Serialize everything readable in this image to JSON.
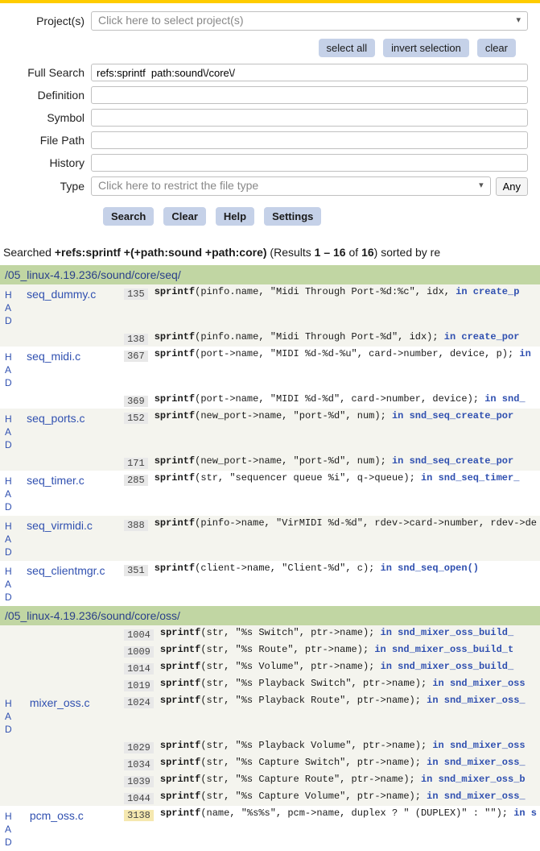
{
  "form": {
    "labels": {
      "projects": "Project(s)",
      "full_search": "Full Search",
      "definition": "Definition",
      "symbol": "Symbol",
      "file_path": "File Path",
      "history": "History",
      "type": "Type"
    },
    "values": {
      "projects_placeholder": "Click here to select project(s)",
      "full_search": "refs:sprintf  path:sound\\/core\\/",
      "definition": "",
      "symbol": "",
      "file_path": "",
      "history": "",
      "type_placeholder": "Click here to restrict the file type"
    },
    "buttons": {
      "select_all": "select all",
      "invert_selection": "invert selection",
      "clear_top": "clear",
      "any": "Any",
      "search": "Search",
      "clear": "Clear",
      "help": "Help",
      "settings": "Settings"
    }
  },
  "status": {
    "prefix": "Searched ",
    "query": "+refs:sprintf +(+path:sound +path:core)",
    "results_label": " (Results ",
    "range": "1 – 16",
    "of_label": " of ",
    "total": "16",
    "suffix": ") sorted by re"
  },
  "had": "H A D",
  "groups": [
    {
      "path": "/05_linux-4.19.236/sound/core/seq/",
      "files": [
        {
          "name": "seq_dummy.c",
          "odd": true,
          "lines": [
            {
              "n": "135",
              "code_pre": "(pinfo.name, \"Midi Through Port-%d:%c\", idx, ",
              "fn": "in create_p",
              "code_post": ""
            },
            {
              "n": "138",
              "code_pre": "(pinfo.name, \"Midi Through Port-%d\", idx); ",
              "fn": "in create_por",
              "code_post": ""
            }
          ]
        },
        {
          "name": "seq_midi.c",
          "odd": false,
          "lines": [
            {
              "n": "367",
              "code_pre": "(port->name, \"MIDI %d-%d-%u\", card->number, device, p); ",
              "fn": "in",
              "code_post": ""
            },
            {
              "n": "369",
              "code_pre": "(port->name, \"MIDI %d-%d\", card->number, device); ",
              "fn": "in snd_",
              "code_post": ""
            }
          ]
        },
        {
          "name": "seq_ports.c",
          "odd": true,
          "lines": [
            {
              "n": "152",
              "code_pre": "(new_port->name, \"port-%d\", num); ",
              "fn": "in snd_seq_create_por",
              "code_post": ""
            },
            {
              "n": "171",
              "code_pre": "(new_port->name, \"port-%d\", num); ",
              "fn": "in snd_seq_create_por",
              "code_post": ""
            }
          ]
        },
        {
          "name": "seq_timer.c",
          "odd": false,
          "lines": [
            {
              "n": "285",
              "code_pre": "(str, \"sequencer queue %i\", q->queue); ",
              "fn": "in snd_seq_timer_",
              "code_post": ""
            }
          ]
        },
        {
          "name": "seq_virmidi.c",
          "odd": true,
          "lines": [
            {
              "n": "388",
              "code_pre": "(pinfo->name, \"VirMIDI %d-%d\", rdev->card->number, rdev->de",
              "fn": "",
              "code_post": ""
            }
          ]
        },
        {
          "name": "seq_clientmgr.c",
          "odd": false,
          "lines": [
            {
              "n": "351",
              "code_pre": "(client->name, \"Client-%d\", c); ",
              "fn": "in snd_seq_open()",
              "code_post": ""
            }
          ]
        }
      ]
    },
    {
      "path": "/05_linux-4.19.236/sound/core/oss/",
      "files": [
        {
          "name": "mixer_oss.c",
          "odd": true,
          "lines": [
            {
              "n": "1004",
              "code_pre": "(str, \"%s Switch\", ptr->name); ",
              "fn": "in snd_mixer_oss_build_",
              "code_post": ""
            },
            {
              "n": "1009",
              "code_pre": "(str, \"%s Route\", ptr->name); ",
              "fn": "in snd_mixer_oss_build_t",
              "code_post": ""
            },
            {
              "n": "1014",
              "code_pre": "(str, \"%s Volume\", ptr->name); ",
              "fn": "in snd_mixer_oss_build_",
              "code_post": ""
            },
            {
              "n": "1019",
              "code_pre": "(str, \"%s Playback Switch\", ptr->name); ",
              "fn": "in snd_mixer_oss",
              "code_post": ""
            },
            {
              "n": "1024",
              "code_pre": "(str, \"%s Playback Route\", ptr->name); ",
              "fn": "in snd_mixer_oss_",
              "code_post": ""
            },
            {
              "n": "1029",
              "code_pre": "(str, \"%s Playback Volume\", ptr->name); ",
              "fn": "in snd_mixer_oss",
              "code_post": ""
            },
            {
              "n": "1034",
              "code_pre": "(str, \"%s Capture Switch\", ptr->name); ",
              "fn": "in snd_mixer_oss_",
              "code_post": ""
            },
            {
              "n": "1039",
              "code_pre": "(str, \"%s Capture Route\", ptr->name); ",
              "fn": "in snd_mixer_oss_b",
              "code_post": ""
            },
            {
              "n": "1044",
              "code_pre": "(str, \"%s Capture Volume\", ptr->name); ",
              "fn": "in snd_mixer_oss_",
              "code_post": ""
            }
          ]
        },
        {
          "name": "pcm_oss.c",
          "odd": false,
          "lines": [
            {
              "n": "3138",
              "hl": true,
              "code_pre": "(name, \"%s%s\", pcm->name, duplex ? \" (DUPLEX)\" : \"\"); ",
              "fn": "in s",
              "code_post": ""
            }
          ]
        }
      ]
    }
  ]
}
